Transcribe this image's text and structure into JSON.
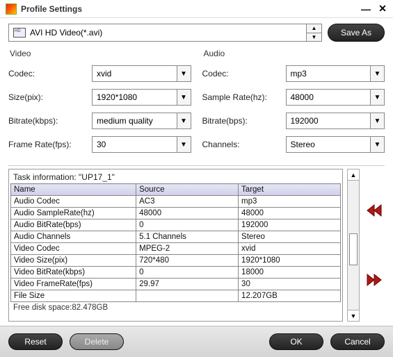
{
  "window": {
    "title": "Profile Settings"
  },
  "profile": {
    "selected": "AVI HD Video(*.avi)",
    "badge": "HD",
    "save_as": "Save As"
  },
  "video": {
    "section": "Video",
    "codec_label": "Codec:",
    "codec": "xvid",
    "size_label": "Size(pix):",
    "size": "1920*1080",
    "bitrate_label": "Bitrate(kbps):",
    "bitrate": "medium quality",
    "framerate_label": "Frame Rate(fps):",
    "framerate": "30"
  },
  "audio": {
    "section": "Audio",
    "codec_label": "Codec:",
    "codec": "mp3",
    "samplerate_label": "Sample Rate(hz):",
    "samplerate": "48000",
    "bitrate_label": "Bitrate(bps):",
    "bitrate": "192000",
    "channels_label": "Channels:",
    "channels": "Stereo"
  },
  "task": {
    "info_prefix": "Task information: ",
    "name": "\"UP17_1\"",
    "columns": [
      "Name",
      "Source",
      "Target"
    ],
    "rows": [
      {
        "name": "Audio Codec",
        "source": "AC3",
        "target": "mp3"
      },
      {
        "name": "Audio SampleRate(hz)",
        "source": "48000",
        "target": "48000"
      },
      {
        "name": "Audio BitRate(bps)",
        "source": "0",
        "target": "192000"
      },
      {
        "name": "Audio Channels",
        "source": "5.1 Channels",
        "target": "Stereo"
      },
      {
        "name": "Video Codec",
        "source": "MPEG-2",
        "target": "xvid"
      },
      {
        "name": "Video Size(pix)",
        "source": "720*480",
        "target": "1920*1080"
      },
      {
        "name": "Video BitRate(kbps)",
        "source": "0",
        "target": "18000"
      },
      {
        "name": "Video FrameRate(fps)",
        "source": "29.97",
        "target": "30"
      },
      {
        "name": "File Size",
        "source": "",
        "target": "12.207GB"
      }
    ],
    "free_disk_label": "Free disk space:",
    "free_disk_value": "82.478GB"
  },
  "footer": {
    "reset": "Reset",
    "delete": "Delete",
    "ok": "OK",
    "cancel": "Cancel"
  }
}
